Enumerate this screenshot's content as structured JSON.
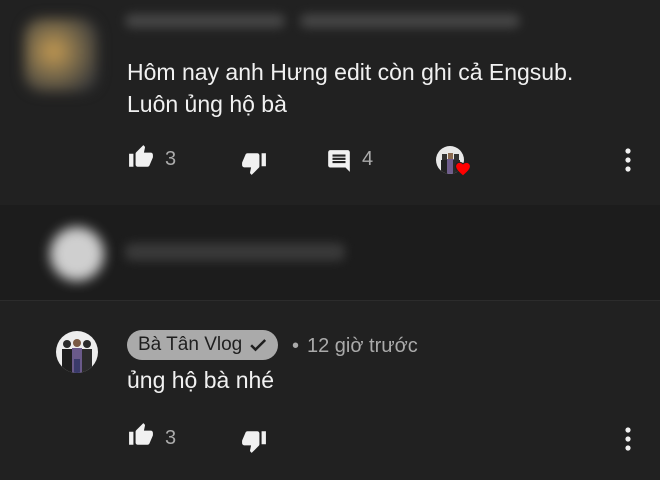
{
  "comment1": {
    "text_line1": "Hôm nay anh Hưng edit còn ghi cả Engsub.",
    "text_line2": "Luôn ủng hộ bà",
    "like_count": "3",
    "reply_count": "4",
    "icons": [
      "thumbs-up-icon",
      "thumbs-down-icon",
      "comment-icon",
      "heart-icon",
      "more-vert-icon"
    ]
  },
  "comment2": {
    "blurred": true
  },
  "comment3": {
    "author": "Bà Tân Vlog",
    "separator": "•",
    "timestamp": "12 giờ trước",
    "text": "ủng hộ bà nhé",
    "like_count": "3",
    "icons": [
      "check-icon",
      "thumbs-up-icon",
      "thumbs-down-icon",
      "more-vert-icon"
    ]
  },
  "colors": {
    "background": "#212121",
    "text": "#f1f1f1",
    "secondary_text": "#aaaaaa",
    "badge": "#aaaaaa",
    "heart": "#ff0000"
  }
}
